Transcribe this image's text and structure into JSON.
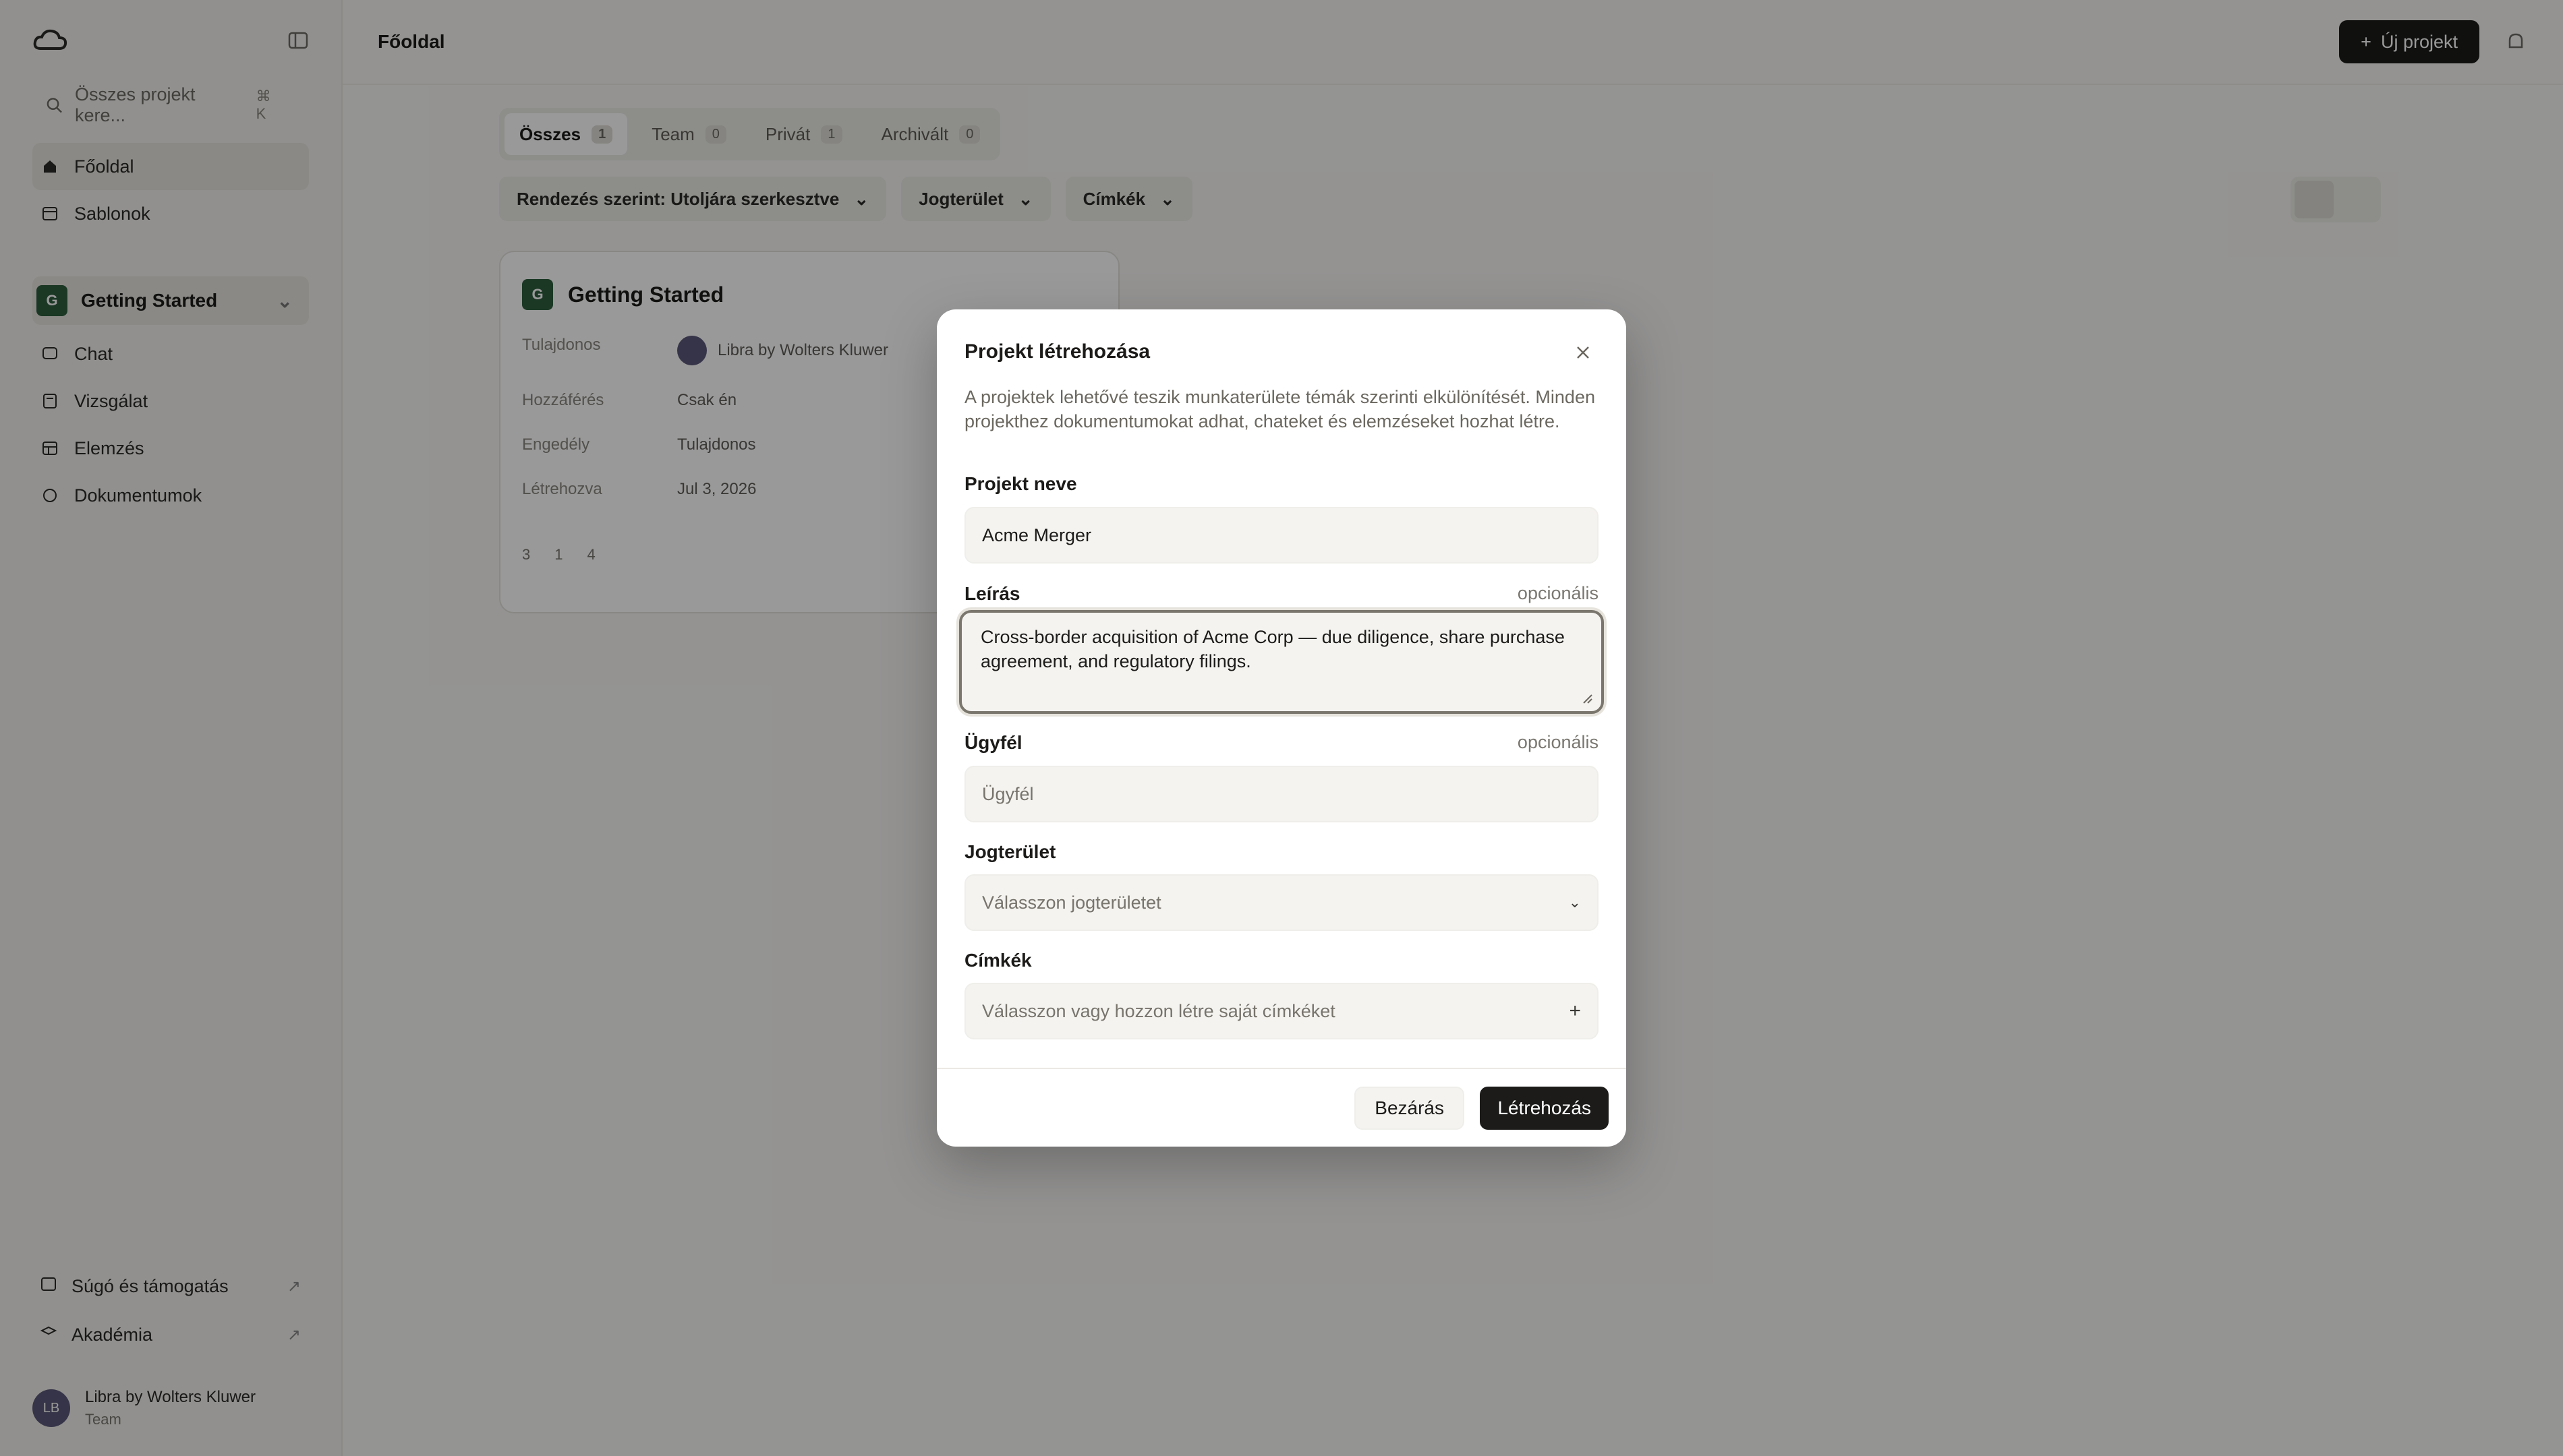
{
  "app": {
    "page_title": "Főoldal",
    "new_project_label": "Új projekt"
  },
  "sidebar": {
    "search_placeholder": "Összes projekt kere...",
    "search_shortcut": "⌘ K",
    "nav": [
      {
        "label": "Főoldal"
      },
      {
        "label": "Sablonok"
      }
    ],
    "project": {
      "badge": "G",
      "name": "Getting Started"
    },
    "project_items": [
      {
        "label": "Chat"
      },
      {
        "label": "Vizsgálat"
      },
      {
        "label": "Elemzés"
      },
      {
        "label": "Dokumentumok"
      }
    ],
    "bottom_links": [
      {
        "label": "Súgó és támogatás"
      },
      {
        "label": "Akadémia"
      }
    ],
    "user": {
      "initials": "LB",
      "name": "Libra by Wolters Kluwer",
      "role": "Team"
    }
  },
  "tabs": [
    {
      "label": "Összes",
      "count": "1"
    },
    {
      "label": "Team",
      "count": "0"
    },
    {
      "label": "Privát",
      "count": "1"
    },
    {
      "label": "Archivált",
      "count": "0"
    }
  ],
  "filters": [
    {
      "label": "Rendezés szerint: Utoljára szerkesztve"
    },
    {
      "label": "Jogterület"
    },
    {
      "label": "Címkék"
    }
  ],
  "card": {
    "badge": "G",
    "title": "Getting Started",
    "rows": [
      {
        "key": "Tulajdonos",
        "value": "Libra by Wolters Kluwer"
      },
      {
        "key": "Hozzáférés",
        "value": "Csak én"
      },
      {
        "key": "Engedély",
        "value": "Tulajdonos"
      },
      {
        "key": "Létrehozva",
        "value": "Jul 3, 2026"
      }
    ],
    "stats": [
      "3",
      "1",
      "4"
    ]
  },
  "modal": {
    "title": "Projekt létrehozása",
    "description": "A projektek lehetővé teszik munkaterülete témák szerinti elkülönítését. Minden projekthez dokumentumokat adhat, chateket és elemzéseket hozhat létre.",
    "name_label": "Projekt neve",
    "name_value": "Acme Merger",
    "desc_label": "Leírás",
    "optional": "opcionális",
    "desc_value": "Cross-border acquisition of Acme Corp — due diligence, share purchase agreement, and regulatory filings.",
    "client_label": "Ügyfél",
    "client_placeholder": "Ügyfél",
    "area_label": "Jogterület",
    "area_placeholder": "Válasszon jogterületet",
    "tags_label": "Címkék",
    "tags_placeholder": "Válasszon vagy hozzon létre saját címkéket",
    "close_button": "Bezárás",
    "create_button": "Létrehozás"
  }
}
